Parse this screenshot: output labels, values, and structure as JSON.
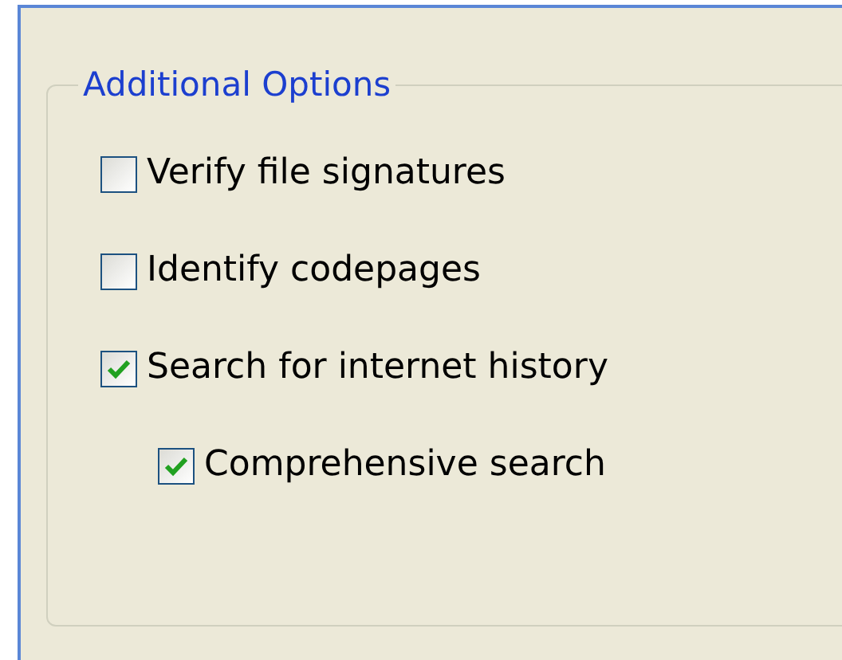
{
  "group": {
    "title": "Additional Options",
    "options": [
      {
        "label": "Verify file signatures",
        "checked": false
      },
      {
        "label": "Identify codepages",
        "checked": false
      },
      {
        "label": "Search for internet history",
        "checked": true,
        "children": [
          {
            "label": "Comprehensive search",
            "checked": true
          }
        ]
      }
    ]
  }
}
